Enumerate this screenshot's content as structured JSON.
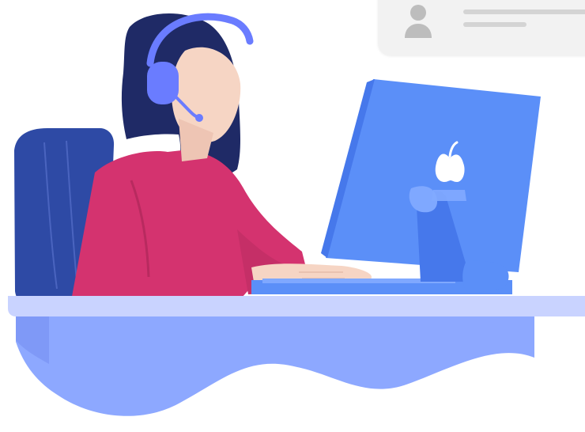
{
  "scene": {
    "subject": "support-agent-at-desk",
    "icons": [
      "headset-icon",
      "user-avatar-icon",
      "apple-logo-icon"
    ]
  },
  "profile_card": {
    "avatar_icon": "user-avatar-icon",
    "line_color": "#d4d4d4",
    "background_color": "#f2f2f2"
  },
  "colors": {
    "sweater": "#d4336f",
    "hair": "#1f2a66",
    "headset": "#6a7cff",
    "chair": "#2e4aa5",
    "monitor": "#5b8ff8",
    "desk_top": "#c9d3ff",
    "desk_base": "#8da8ff",
    "skin": "#f6d5c4"
  }
}
